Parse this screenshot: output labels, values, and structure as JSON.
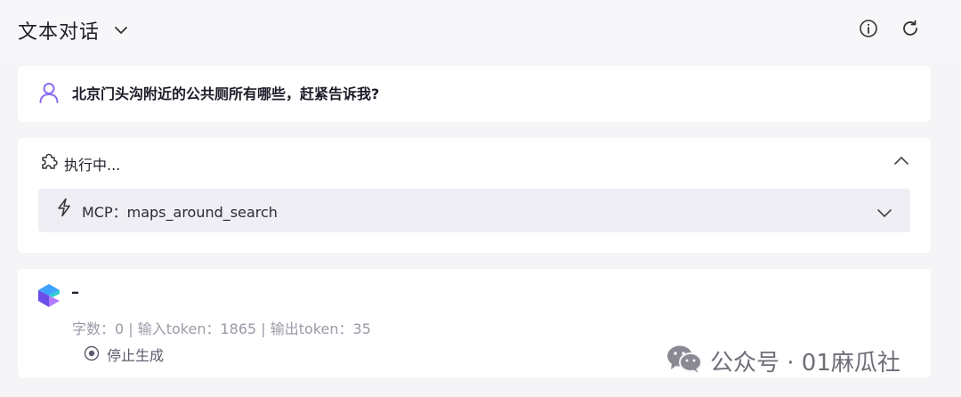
{
  "header": {
    "title": "文本对话",
    "icons": [
      "chevron-down-icon",
      "info-icon",
      "refresh-icon"
    ]
  },
  "question": {
    "text": "北京门头沟附近的公共厕所有哪些，赶紧告诉我?",
    "icon": "user-icon"
  },
  "execution": {
    "status_label": "执行中...",
    "tool_call": "MCP：maps_around_search",
    "icons": [
      "puzzle-icon",
      "chevron-up-icon",
      "lightning-icon",
      "chevron-down-icon"
    ]
  },
  "answer": {
    "cursor": "–",
    "stats": "字数：0 | 输入token：1865 | 输出token：35",
    "stop_label": "停止生成",
    "icons": [
      "assistant-logo-icon",
      "stop-circle-icon"
    ]
  },
  "watermark": {
    "text": "公众号 · 01麻瓜社",
    "icon": "wechat-icon"
  },
  "colors": {
    "accent_purple": "#8b6cf0",
    "background": "#f5f5f8",
    "card": "#ffffff",
    "mcp_box": "#eeeef4",
    "muted_text": "#9a9aa8"
  }
}
